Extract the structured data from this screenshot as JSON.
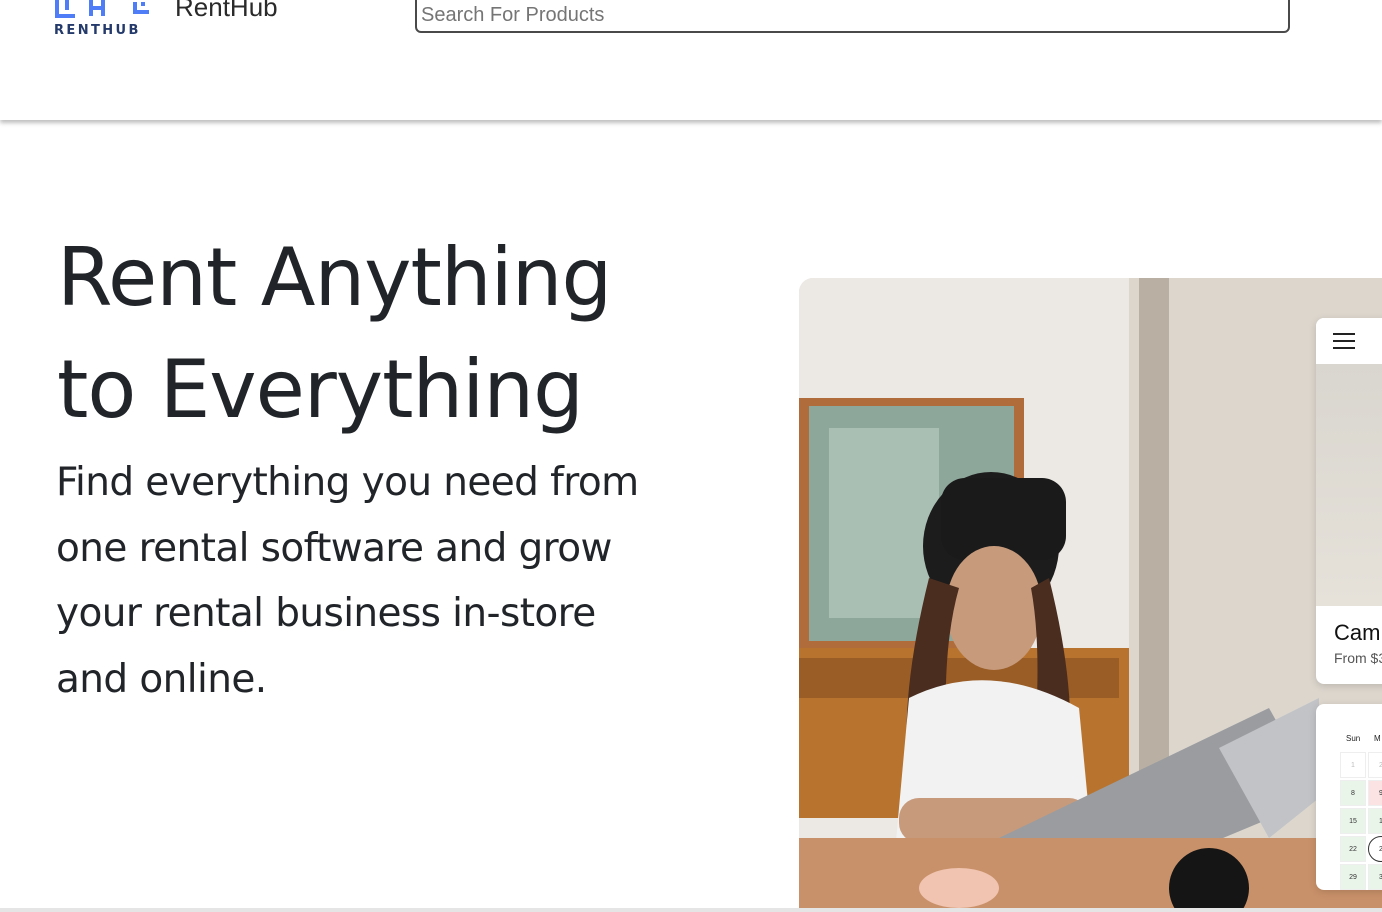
{
  "header": {
    "logo_text": "RENTHUB",
    "brand_name": "RentHub",
    "search_placeholder": "Search For Products"
  },
  "hero": {
    "title_line1": "Rent Anything",
    "title_line2": "to Everything",
    "subtitle": "Find everything you need from one rental software and grow your rental business in-store and online."
  },
  "phone_card": {
    "caption_title": "Cam",
    "caption_price": "From $3"
  },
  "calendar": {
    "weekday_1": "Sun",
    "weekday_2": "M",
    "days": [
      "1",
      "8",
      "15",
      "22",
      "29"
    ],
    "days_col2": [
      "2",
      "9",
      "1",
      "2",
      "3"
    ]
  },
  "colors": {
    "brand_blue": "#4f7cf7",
    "logo_text": "#243a6b",
    "text": "#212529"
  }
}
